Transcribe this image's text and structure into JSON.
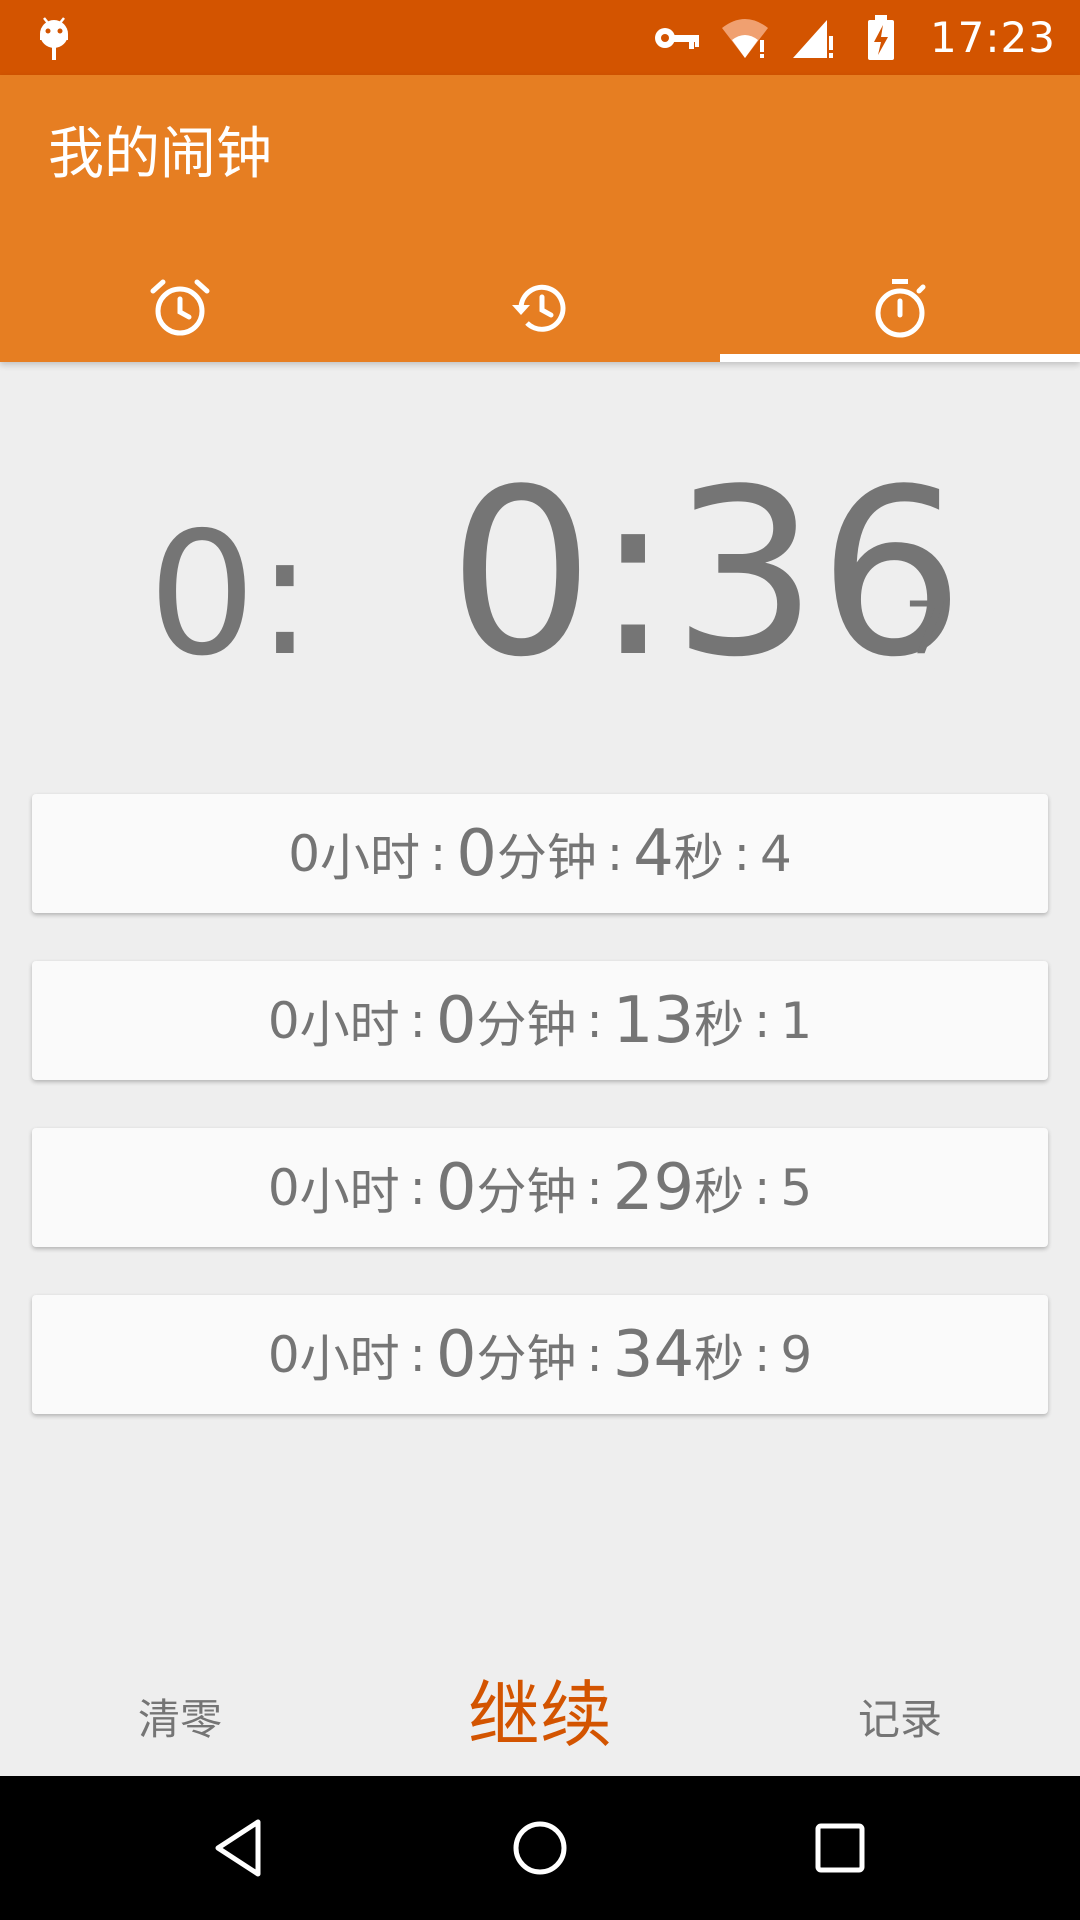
{
  "status_bar": {
    "time": "17:23",
    "background": "#d35400",
    "icons": [
      "android-icon",
      "key-icon",
      "wifi-icon",
      "signal-icon",
      "battery-charging-icon"
    ]
  },
  "app_bar": {
    "title": "我的闹钟",
    "background": "#e67e22",
    "tabs": [
      {
        "icon": "alarm-clock-icon",
        "active": false
      },
      {
        "icon": "history-clock-icon",
        "active": false
      },
      {
        "icon": "stopwatch-icon",
        "active": true
      }
    ]
  },
  "timer": {
    "hours": "0:",
    "main": "0:36",
    "fraction": "7"
  },
  "laps": [
    {
      "hours": "0",
      "hours_unit": "小时",
      "minutes": "0",
      "minutes_unit": "分钟",
      "seconds": "4",
      "seconds_unit": "秒",
      "fraction": "4"
    },
    {
      "hours": "0",
      "hours_unit": "小时",
      "minutes": "0",
      "minutes_unit": "分钟",
      "seconds": "13",
      "seconds_unit": "秒",
      "fraction": "1"
    },
    {
      "hours": "0",
      "hours_unit": "小时",
      "minutes": "0",
      "minutes_unit": "分钟",
      "seconds": "29",
      "seconds_unit": "秒",
      "fraction": "5"
    },
    {
      "hours": "0",
      "hours_unit": "小时",
      "minutes": "0",
      "minutes_unit": "分钟",
      "seconds": "34",
      "seconds_unit": "秒",
      "fraction": "9"
    }
  ],
  "lap_separator": ":",
  "actions": {
    "clear": "清零",
    "continue": "继续",
    "record": "记录",
    "accent": "#d35400"
  },
  "nav_bar": {
    "icons": [
      "back-icon",
      "home-icon",
      "recents-icon"
    ]
  }
}
